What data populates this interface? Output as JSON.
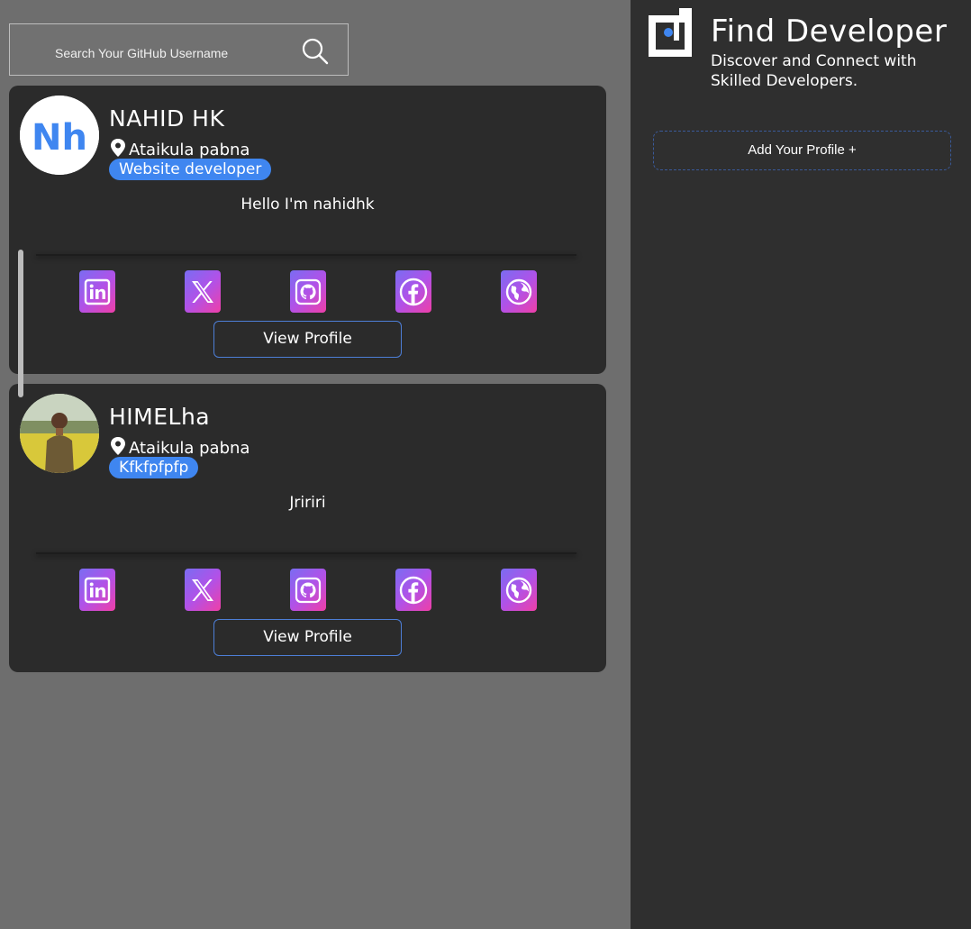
{
  "search": {
    "placeholder": "Search Your GitHub Username"
  },
  "header": {
    "title": "Find Developer",
    "subtitle": "Discover and Connect with Skilled Developers.",
    "add_label": "Add Your Profile +"
  },
  "profiles": [
    {
      "name": "NAHID HK",
      "avatar_text": "Nh",
      "location": "Ataikula pabna",
      "role": "Website developer",
      "bio": "Hello I'm nahidhk",
      "view_label": "View Profile"
    },
    {
      "name": "HIMELha",
      "location": "Ataikula pabna",
      "role": "Kfkfpfpfp",
      "bio": "Jririri",
      "view_label": "View Profile"
    }
  ],
  "colors": {
    "page_bg": "#6e6e6e",
    "card_bg": "#2b2b2b",
    "panel_bg": "#2f2f2f",
    "accent": "#3f86f0",
    "icon_gradient_start": "#7a6cf2",
    "icon_gradient_end": "#ef3fa8"
  },
  "icons": [
    "linkedin-icon",
    "x-icon",
    "github-icon",
    "facebook-icon",
    "globe-icon"
  ]
}
